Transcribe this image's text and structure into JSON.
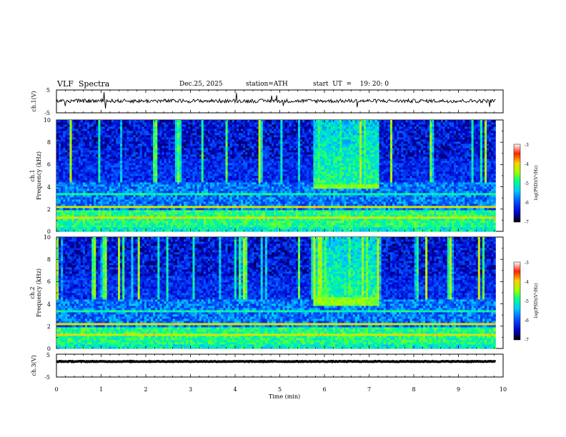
{
  "header": {
    "title": "VLF  Spectra",
    "date": "Dec.25, 2025",
    "station": "station=ATH",
    "start": "start  UT  =    19: 20: 0"
  },
  "colors": {
    "background": "#ffffff",
    "axis": "#000000",
    "trace": "#000000",
    "colormap": [
      "#000000",
      "#0000c8",
      "#0050ff",
      "#00c8ff",
      "#00ff90",
      "#a0ff00",
      "#ffd000",
      "#ff2000",
      "#ffffff"
    ]
  },
  "chart_data": [
    {
      "type": "line",
      "name": "ch1-waveform",
      "ylabel": "ch.1(V)",
      "ylim": [
        -5,
        5
      ],
      "yticks": [
        "5",
        "-5"
      ],
      "xlim": [
        0,
        10
      ],
      "description_values": {
        "mean": 0.2,
        "noise_amplitude": 0.8,
        "spikes": true
      }
    },
    {
      "type": "heatmap",
      "name": "ch1-spectrogram",
      "ylabel": "Frequency  (kHz)",
      "channel_label": "ch.1",
      "ylim": [
        0,
        10
      ],
      "yticks": [
        "0",
        "2",
        "4",
        "6",
        "8",
        "10"
      ],
      "xlim": [
        0,
        10
      ],
      "data_end_min": 9.83,
      "colorbar": {
        "label": "log(PSD)(V²/Hz)",
        "range": [
          -7,
          -3
        ],
        "ticks": [
          "-3",
          "-4",
          "-5",
          "-6",
          "-7"
        ]
      },
      "features": {
        "event_start_min": 5.75,
        "event_end_min": 7.2,
        "event_band_khz": [
          3.8,
          4.3
        ]
      }
    },
    {
      "type": "heatmap",
      "name": "ch2-spectrogram",
      "ylabel": "Frequency  (kHz)",
      "channel_label": "ch.2",
      "ylim": [
        0,
        10
      ],
      "yticks": [
        "0",
        "2",
        "4",
        "6",
        "8",
        "10"
      ],
      "xlim": [
        0,
        10
      ],
      "data_end_min": 9.83,
      "colorbar": {
        "label": "log(PSD)(V²/Hz)",
        "range": [
          -7,
          -3
        ],
        "ticks": [
          "-3",
          "-4",
          "-5",
          "-6",
          "-7"
        ]
      },
      "features": {
        "event_start_min": 5.75,
        "event_end_min": 7.2,
        "event_band_khz": [
          3.8,
          4.6
        ]
      }
    },
    {
      "type": "line",
      "name": "ch3-waveform",
      "ylabel": "ch.3(V)",
      "ylim": [
        -5,
        5
      ],
      "yticks": [
        "5",
        "-5"
      ],
      "xlabel": "Time  (min)",
      "xlim": [
        0,
        10
      ],
      "xticks": [
        "0",
        "1",
        "2",
        "3",
        "4",
        "5",
        "6",
        "7",
        "8",
        "9",
        "10"
      ],
      "description_values": {
        "mean": 1.8,
        "noise_amplitude": 0.15,
        "spikes": false
      }
    }
  ]
}
